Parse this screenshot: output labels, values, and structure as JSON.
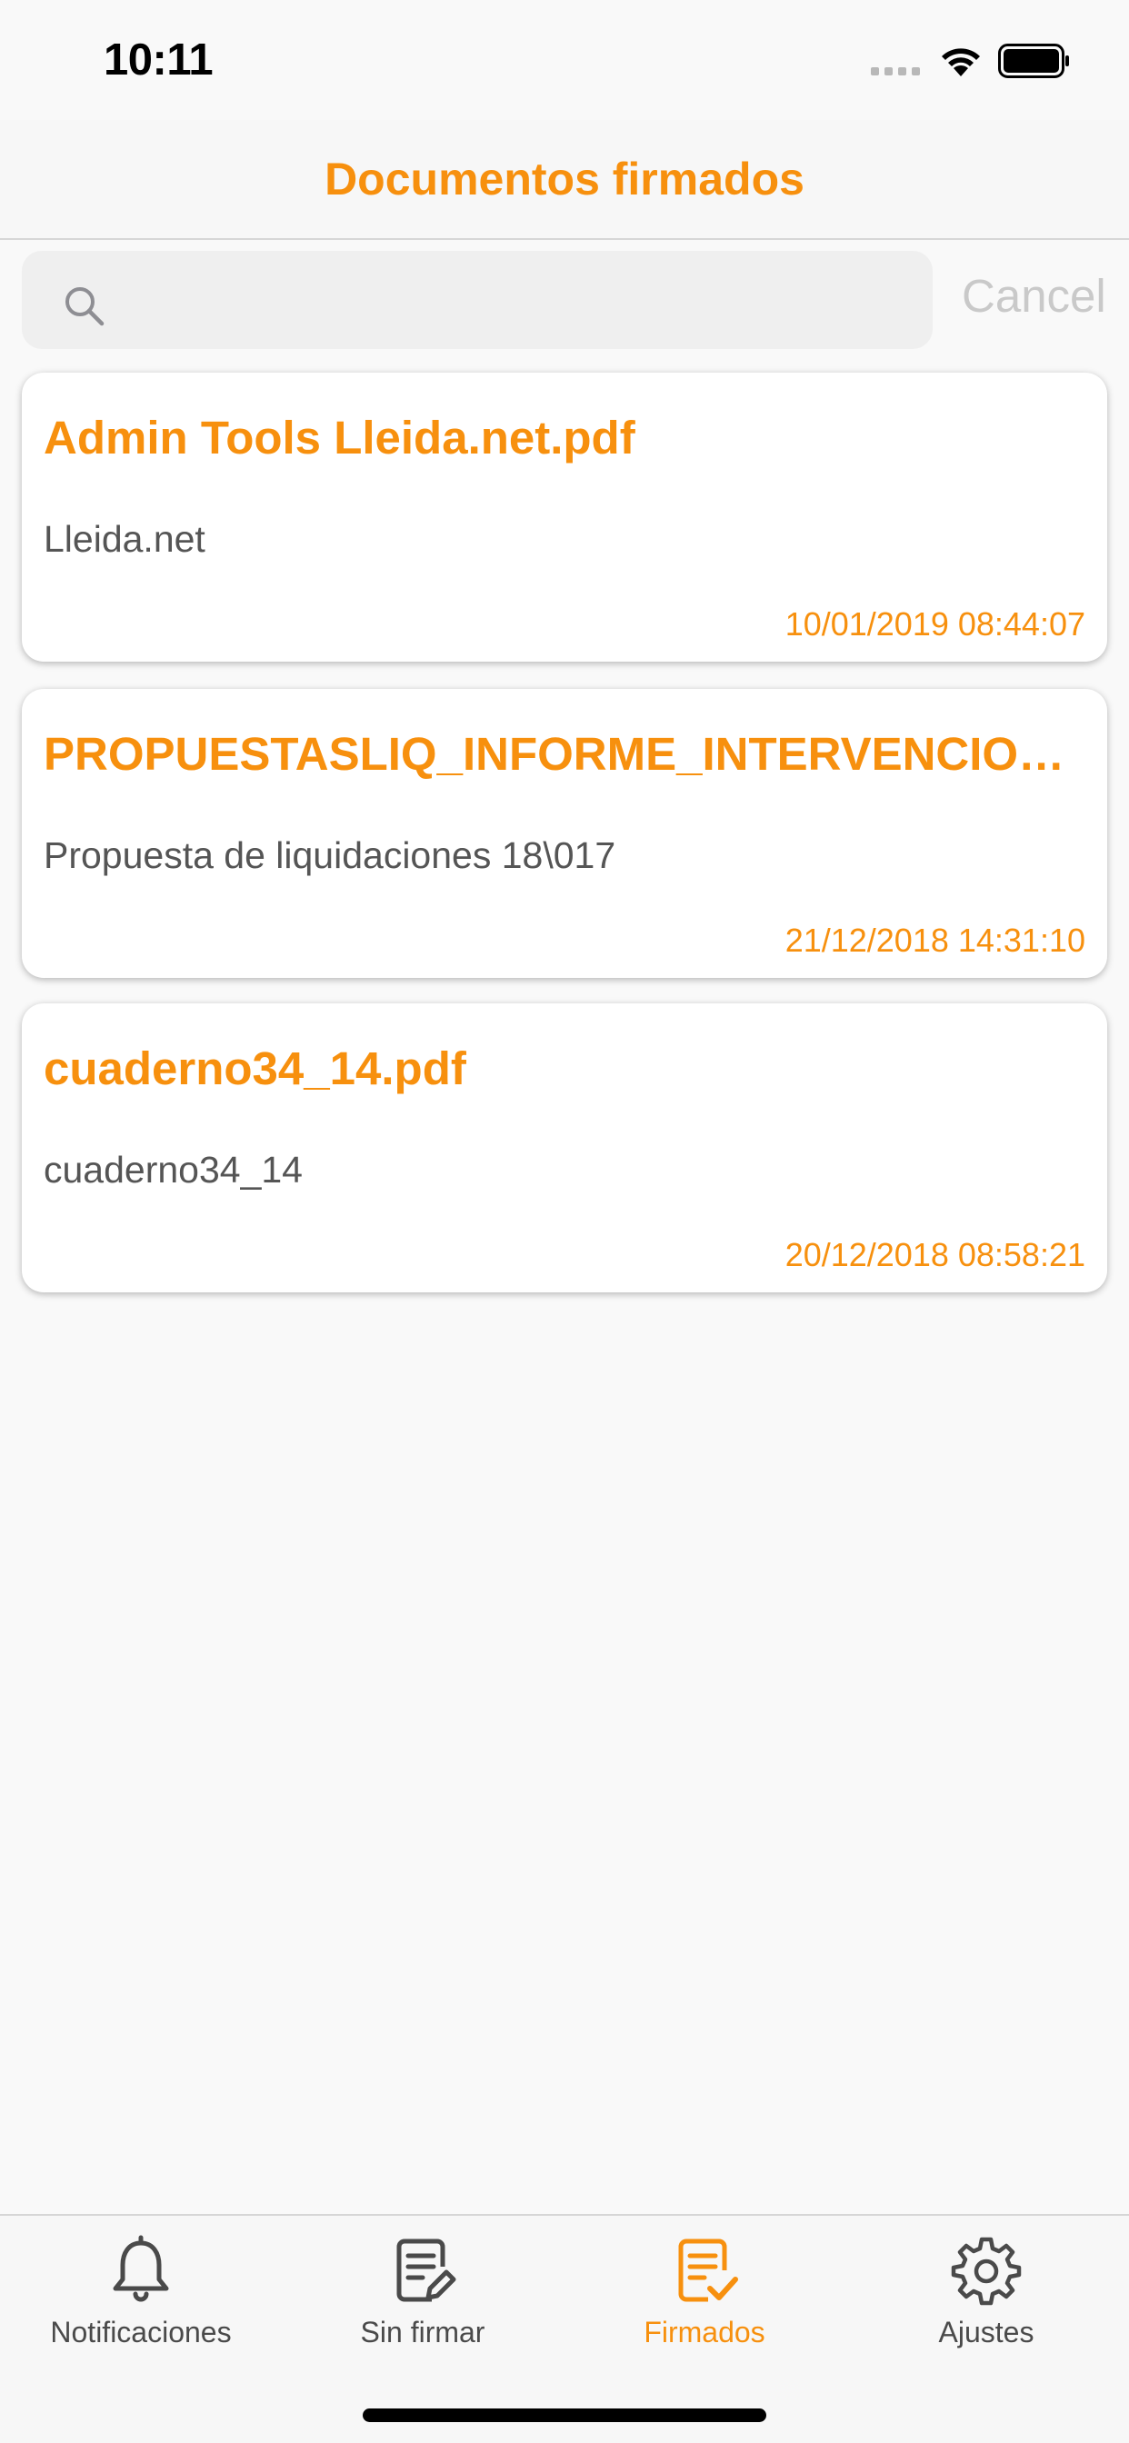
{
  "status_bar": {
    "time": "10:11"
  },
  "nav": {
    "title": "Documentos firmados"
  },
  "search": {
    "placeholder": "",
    "cancel_label": "Cancel"
  },
  "documents": [
    {
      "title": "Admin Tools Lleida.net.pdf",
      "subtitle": "Lleida.net",
      "date": "10/01/2019 08:44:07"
    },
    {
      "title": "PROPUESTASLIQ_INFORME_INTERVENCION...",
      "subtitle": "Propuesta de liquidaciones 18\\017",
      "date": "21/12/2018 14:31:10"
    },
    {
      "title": "cuaderno34_14.pdf",
      "subtitle": "cuaderno34_14",
      "date": "20/12/2018 08:58:21"
    }
  ],
  "tabs": [
    {
      "label": "Notificaciones",
      "icon": "bell-icon",
      "active": false
    },
    {
      "label": "Sin firmar",
      "icon": "document-edit-icon",
      "active": false
    },
    {
      "label": "Firmados",
      "icon": "document-check-icon",
      "active": true
    },
    {
      "label": "Ajustes",
      "icon": "gear-icon",
      "active": false
    }
  ],
  "colors": {
    "accent": "#f7900e",
    "background": "#f9f9f9",
    "inactive": "#4a4a4a"
  }
}
